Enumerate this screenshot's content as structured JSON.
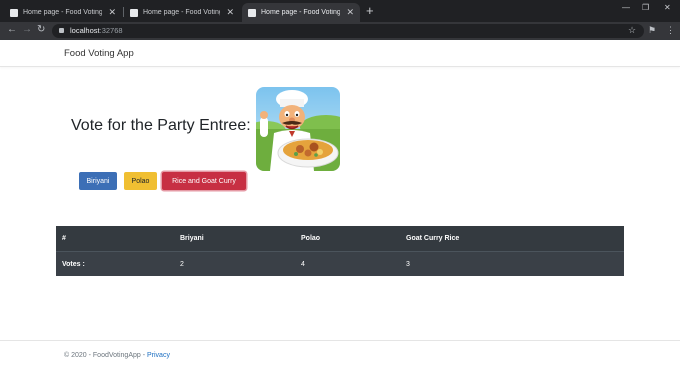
{
  "browser": {
    "tabs": [
      {
        "title": "Home page - Food Voting",
        "active": false
      },
      {
        "title": "Home page - Food Voting",
        "active": false
      },
      {
        "title": "Home page - Food Voting",
        "active": true
      }
    ],
    "url_host": "localhost",
    "url_port": ":32768"
  },
  "navbar": {
    "brand": "Food Voting App"
  },
  "main": {
    "heading": "Vote for the Party Entree:",
    "buttons": [
      {
        "label": "Biriyani",
        "color": "#3c6fb6"
      },
      {
        "label": "Polao",
        "color": "#f0bf32"
      },
      {
        "label": "Rice and Goat Curry",
        "color": "#c72f43"
      }
    ]
  },
  "table": {
    "headers": [
      "#",
      "Briyani",
      "Polao",
      "Goat Curry Rice"
    ],
    "rows": [
      [
        "Votes :",
        "2",
        "4",
        "3"
      ]
    ]
  },
  "footer": {
    "text": "© 2020 - FoodVotingApp - ",
    "link": "Privacy"
  }
}
